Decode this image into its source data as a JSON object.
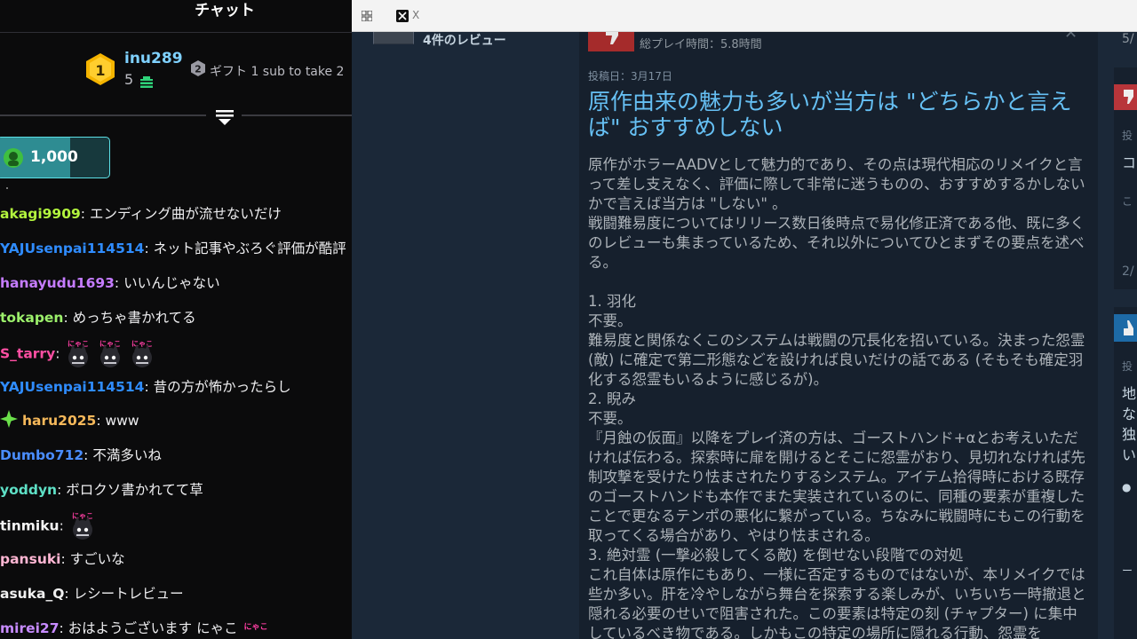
{
  "chat": {
    "title": "チャット",
    "leader": {
      "rank": "1",
      "name": "inu289",
      "count": "5"
    },
    "runner_up": {
      "rank": "2",
      "text": "ギフト 1 sub to take 2"
    },
    "sub_goal": {
      "value": "1,000",
      "progress_fraction": 0.65
    },
    "messages": [
      {
        "user": "akagi9909",
        "color": "#b3f53e",
        "sep": ": ",
        "text": "エンディング曲が流せないだけ"
      },
      {
        "user": "YAJUsenpai114514",
        "color": "#2f8cff",
        "sep": ": ",
        "text": "ネット記事やぶろぐ評価が酷評"
      },
      {
        "user": "hanayudu1693",
        "color": "#c57cff",
        "sep": ": ",
        "text": "いいんじゃない"
      },
      {
        "user": "tokapen",
        "color": "#9cf06b",
        "sep": ": ",
        "text": "めっちゃ書かれてる"
      },
      {
        "user": "S_tarry",
        "color": "#ff4fa3",
        "sep": ": ",
        "text": "",
        "emotes": 3
      },
      {
        "user": "YAJUsenpai114514",
        "color": "#2f8cff",
        "sep": ": ",
        "text": "昔の方が怖かったらし"
      },
      {
        "user": "haru2025",
        "color": "#f5b85a",
        "sep": ": ",
        "text": "www",
        "badge": "star"
      },
      {
        "user": "Dumbo712",
        "color": "#4a8dff",
        "sep": ": ",
        "text": "不満多いね"
      },
      {
        "user": "yoddyn",
        "color": "#5ee0c6",
        "sep": ": ",
        "text": "ボロクソ書かれてて草"
      },
      {
        "user": "tinmiku",
        "color": "#f5f5f5",
        "sep": ": ",
        "text": "",
        "emotes": 1
      },
      {
        "user": "pansuki",
        "color": "#ffb6d3",
        "sep": ": ",
        "text": "すごいな"
      },
      {
        "user": "asuka_Q",
        "color": "#f0f0f0",
        "sep": ": ",
        "text": "レシートレビュー"
      },
      {
        "user": "mirei27",
        "color": "#c78bff",
        "sep": ": ",
        "text": "おはようございます にゃこ"
      }
    ],
    "emote_label": "にゃこ"
  },
  "browser": {
    "tab_title": "X"
  },
  "review": {
    "review_count": "4件のレビュー",
    "playtime": "総プレイ時間：5.8時間",
    "post_date": "投稿日：3月17日",
    "title": "原作由来の魅力も多いが当方は \"どちらかと言えば\" おすすめしない",
    "body": "原作がホラーAADVとして魅力的であり、その点は現代相応のリメイクと言って差し支えなく、評価に際して非常に迷うものの、おすすめするかしないかで言えば当方は \"しない\" 。\n戦闘難易度についてはリリース数日後時点で易化修正済である他、既に多くのレビューも集まっているため、それ以外についてひとまずその要点を述べる。\n\n1. 羽化\n不要。\n難易度と関係なくこのシステムは戦闘の冗長化を招いている。決まった怨霊 (敵) に確定で第二形態などを設ければ良いだけの話である (そもそも確定羽化する怨霊もいるように感じるが)。\n2. 睨み\n不要。\n『月蝕の仮面』以降をプレイ済の方は、ゴーストハンド+αとお考えいただければ伝わる。探索時に扉を開けるとそこに怨霊がおり、見切れなければ先制攻撃を受けたり怯まされたりするシステム。アイテム拾得時における既存のゴーストハンドも本作でまた実装されているのに、同種の要素が重複したことで更なるテンポの悪化に繋がっている。ちなみに戦闘時にもこの行動を取ってくる場合があり、やはり怯まされる。\n3. 絶対霊 (一撃必殺してくる敵) を倒せない段階での対処\nこれ自体は原作にもあり、一様に否定するものではないが、本リメイクでは些か多い。肝を冷やしながら舞台を探索する楽しみが、いちいち一時撤退と隠れる必要のせいで阻害された。この要素は特定の刻 (チャプター) に集中しているべき物である。しかもこの特定の場所に隠れる行動、怨霊を"
  },
  "right_strip": {
    "top_text": "5/",
    "posted_1": "投",
    "line_1": "コ",
    "line_2": "こ",
    "date_1": "2/",
    "posted_2": "投",
    "lines": [
      "地",
      "な",
      "独",
      "い"
    ],
    "bullet": "●",
    "dash": "ー"
  }
}
